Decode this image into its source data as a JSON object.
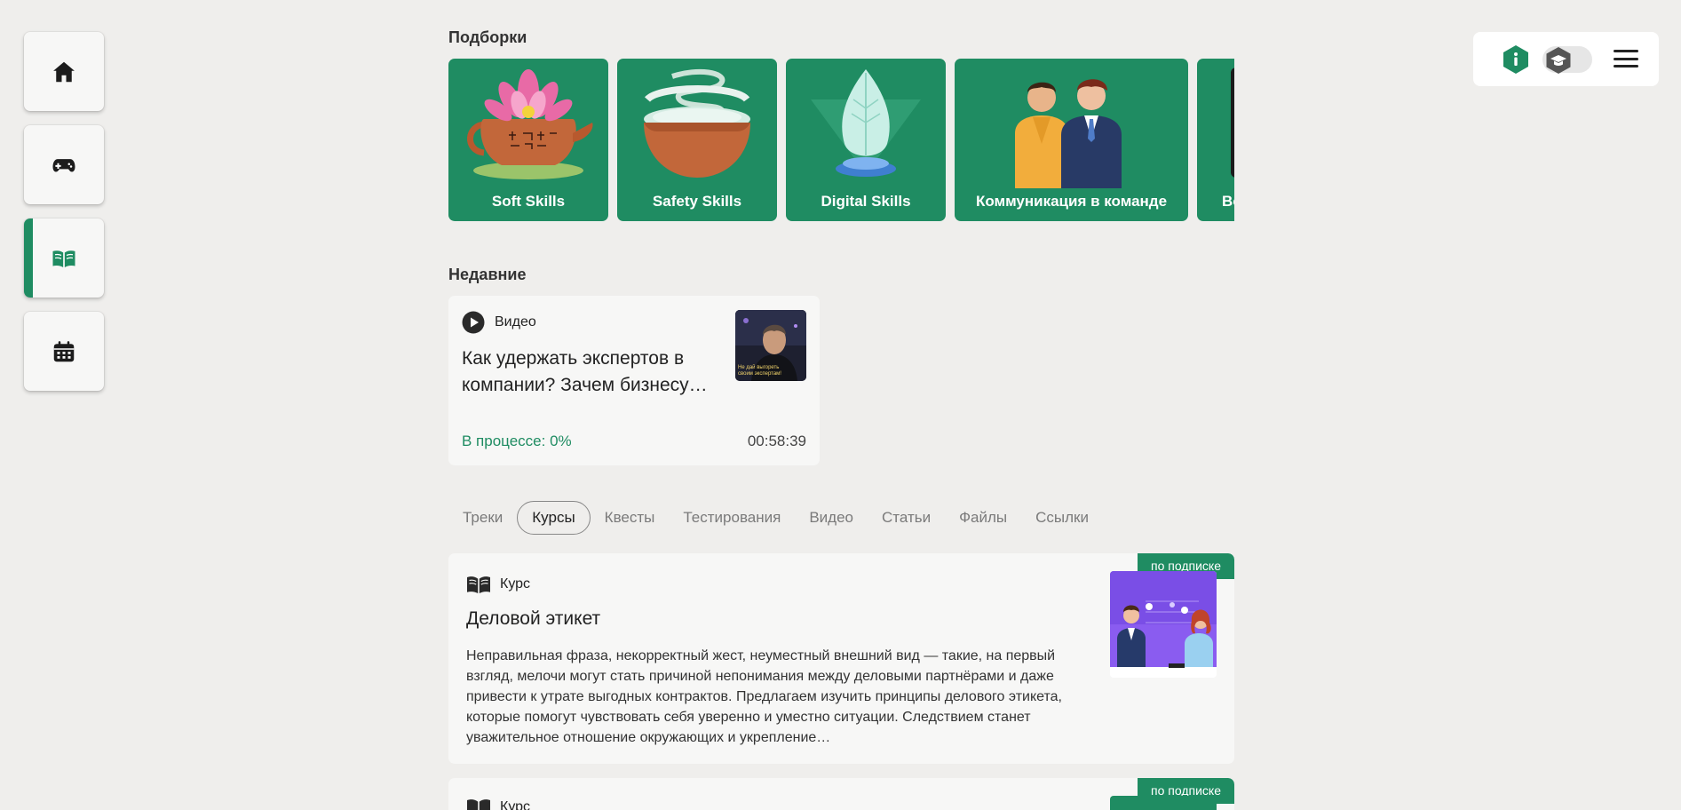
{
  "nav": {
    "items": [
      {
        "name": "home",
        "icon": "home-icon",
        "active": false
      },
      {
        "name": "games",
        "icon": "gamepad-icon",
        "active": false
      },
      {
        "name": "library",
        "icon": "book-open-icon",
        "active": true
      },
      {
        "name": "calendar",
        "icon": "calendar-icon",
        "active": false
      }
    ]
  },
  "toolbar": {
    "info_icon": "info-hexagon-icon",
    "toggle_icon": "graduation-cap-icon",
    "menu_icon": "hamburger-menu-icon"
  },
  "collections": {
    "title": "Подборки",
    "items": [
      {
        "label": "Soft Skills",
        "icon": "lotus-teapot-art"
      },
      {
        "label": "Safety Skills",
        "icon": "steaming-bowl-art"
      },
      {
        "label": "Digital Skills",
        "icon": "crystal-leaf-art"
      },
      {
        "label": "Коммуникация в команде",
        "icon": "two-businessmen-art"
      },
      {
        "label": "Во",
        "icon": "partial-card-art"
      }
    ]
  },
  "recent": {
    "title": "Недавние",
    "card": {
      "type": "Видео",
      "title": "Как удержать экспертов в компании? Зачем бизнесу…",
      "thumb_caption": "Не дай выгореть своим экспертам!",
      "status": "В процессе: 0%",
      "duration": "00:58:39"
    }
  },
  "tabs": [
    {
      "label": "Треки",
      "active": false
    },
    {
      "label": "Курсы",
      "active": true
    },
    {
      "label": "Квесты",
      "active": false
    },
    {
      "label": "Тестирования",
      "active": false
    },
    {
      "label": "Видео",
      "active": false
    },
    {
      "label": "Статьи",
      "active": false
    },
    {
      "label": "Файлы",
      "active": false
    },
    {
      "label": "Ссылки",
      "active": false
    }
  ],
  "courses": [
    {
      "badge": "по подписке",
      "type": "Курс",
      "title": "Деловой этикет",
      "description": "Неправильная фраза, некорректный жест, неуместный внешний вид — такие, на первый взгляд, мелочи могут стать причиной непонимания между деловыми партнёрами и даже привести к утрате выгодных контрактов. Предлагаем изучить принципы делового этикета, которые помогут чувствовать себя уверенно и уместно ситуации. Следствием станет уважительное отношение окружающих и укрепление…"
    },
    {
      "badge": "по подписке",
      "type": "Курс"
    }
  ],
  "colors": {
    "accent": "#1f8c62",
    "background": "#efeeec",
    "card": "#f7f7f6"
  }
}
